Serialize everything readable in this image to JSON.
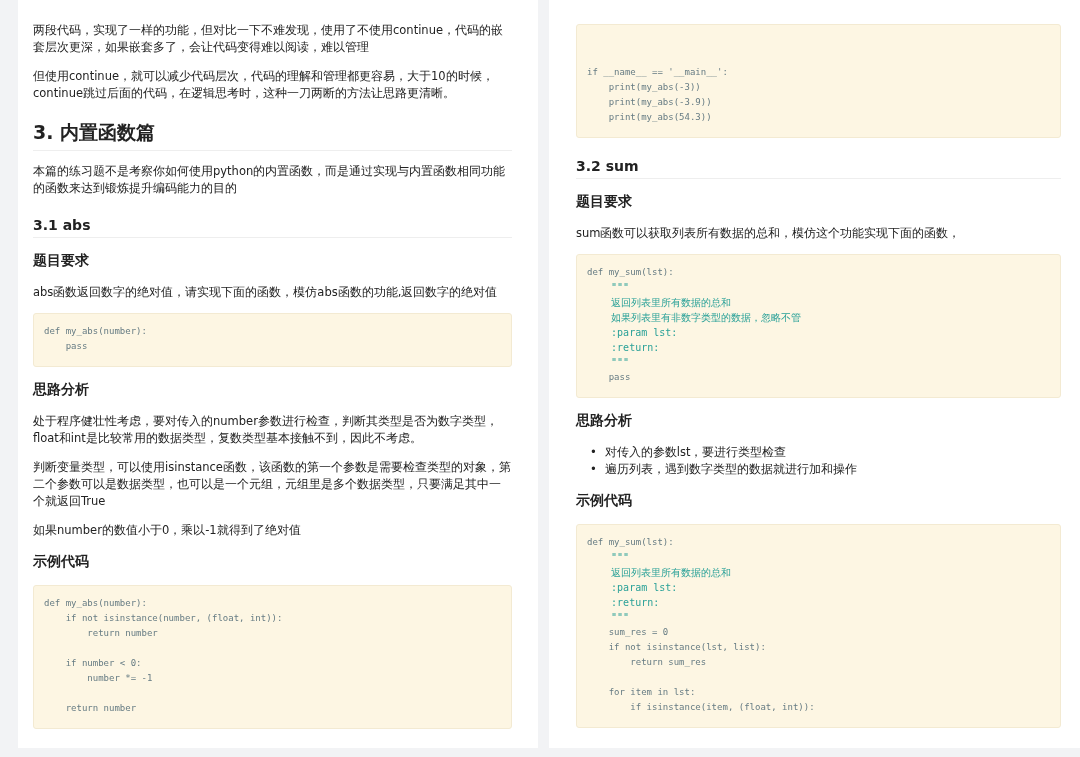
{
  "pages": [
    {
      "blocks": [
        {
          "kind": "paragraph",
          "text": "两段代码，实现了一样的功能，但对比一下不难发现，使用了不使用continue，代码的嵌套层次更深，如果嵌套多了，会让代码变得难以阅读，难以管理"
        },
        {
          "kind": "paragraph",
          "text": "但使用continue，就可以减少代码层次，代码的理解和管理都更容易，大于10的时候，continue跳过后面的代码，在逻辑思考时，这种一刀两断的方法让思路更清晰。"
        },
        {
          "kind": "h2",
          "text": "3. 内置函数篇"
        },
        {
          "kind": "paragraph",
          "text": "本篇的练习题不是考察你如何使用python的内置函数，而是通过实现与内置函数相同功能的函数来达到锻炼提升编码能力的目的"
        },
        {
          "kind": "h3",
          "text": "3.1 abs"
        },
        {
          "kind": "h4",
          "text": "题目要求"
        },
        {
          "kind": "paragraph",
          "text": "abs函数返回数字的绝对值，请实现下面的函数，模仿abs函数的功能,返回数字的绝对值"
        },
        {
          "kind": "code",
          "lines": [
            {
              "kind": "code",
              "text": "def my_abs(number):"
            },
            {
              "kind": "code",
              "text": "    pass"
            }
          ]
        },
        {
          "kind": "h4",
          "text": "思路分析"
        },
        {
          "kind": "paragraph",
          "text": "处于程序健壮性考虑，要对传入的number参数进行检查，判断其类型是否为数字类型，float和int是比较常用的数据类型，复数类型基本接触不到，因此不考虑。"
        },
        {
          "kind": "paragraph",
          "text": "判断变量类型，可以使用isinstance函数，该函数的第一个参数是需要检查类型的对象，第二个参数可以是数据类型，也可以是一个元组，元组里是多个数据类型，只要满足其中一个就返回True"
        },
        {
          "kind": "paragraph",
          "text": "如果number的数值小于0，乘以-1就得到了绝对值"
        },
        {
          "kind": "h4",
          "text": "示例代码"
        },
        {
          "kind": "code",
          "lines": [
            {
              "kind": "code",
              "text": "def my_abs(number):"
            },
            {
              "kind": "code",
              "text": "    if not isinstance(number, (float, int)):"
            },
            {
              "kind": "code",
              "text": "        return number"
            },
            {
              "kind": "blank"
            },
            {
              "kind": "code",
              "text": "    if number < 0:"
            },
            {
              "kind": "code",
              "text": "        number *= -1"
            },
            {
              "kind": "blank"
            },
            {
              "kind": "code",
              "text": "    return number"
            }
          ]
        }
      ]
    },
    {
      "blocks": [
        {
          "kind": "code",
          "lines": [
            {
              "kind": "blank"
            },
            {
              "kind": "blank"
            },
            {
              "kind": "code",
              "text": "if __name__ == '__main__':"
            },
            {
              "kind": "code",
              "text": "    print(my_abs(-3))"
            },
            {
              "kind": "code",
              "text": "    print(my_abs(-3.9))"
            },
            {
              "kind": "code",
              "text": "    print(my_abs(54.3))"
            }
          ]
        },
        {
          "kind": "h3",
          "text": "3.2 sum"
        },
        {
          "kind": "h4",
          "text": "题目要求"
        },
        {
          "kind": "paragraph",
          "text": "sum函数可以获取列表所有数据的总和，模仿这个功能实现下面的函数，"
        },
        {
          "kind": "code",
          "lines": [
            {
              "kind": "code",
              "text": "def my_sum(lst):"
            },
            {
              "kind": "doc",
              "text": "    \"\"\""
            },
            {
              "kind": "doc",
              "text": "    返回列表里所有数据的总和"
            },
            {
              "kind": "doc",
              "text": "    如果列表里有非数字类型的数据，忽略不管"
            },
            {
              "kind": "doc",
              "text": "    :param lst:"
            },
            {
              "kind": "doc",
              "text": "    :return:"
            },
            {
              "kind": "doc",
              "text": "    \"\"\""
            },
            {
              "kind": "code",
              "text": "    pass"
            }
          ]
        },
        {
          "kind": "h4",
          "text": "思路分析"
        },
        {
          "kind": "list",
          "items": [
            {
              "marker": "•",
              "text": "对传入的参数lst，要进行类型检查"
            },
            {
              "marker": "•",
              "text": "遍历列表，遇到数字类型的数据就进行加和操作"
            }
          ]
        },
        {
          "kind": "h4",
          "text": "示例代码"
        },
        {
          "kind": "code",
          "lines": [
            {
              "kind": "code",
              "text": "def my_sum(lst):"
            },
            {
              "kind": "doc",
              "text": "    \"\"\""
            },
            {
              "kind": "doc",
              "text": "    返回列表里所有数据的总和"
            },
            {
              "kind": "doc",
              "text": "    :param lst:"
            },
            {
              "kind": "doc",
              "text": "    :return:"
            },
            {
              "kind": "doc",
              "text": "    \"\"\""
            },
            {
              "kind": "code",
              "text": "    sum_res = 0"
            },
            {
              "kind": "code",
              "text": "    if not isinstance(lst, list):"
            },
            {
              "kind": "code",
              "text": "        return sum_res"
            },
            {
              "kind": "blank"
            },
            {
              "kind": "code",
              "text": "    for item in lst:"
            },
            {
              "kind": "code",
              "text": "        if isinstance(item, (float, int)):"
            }
          ]
        }
      ]
    }
  ]
}
